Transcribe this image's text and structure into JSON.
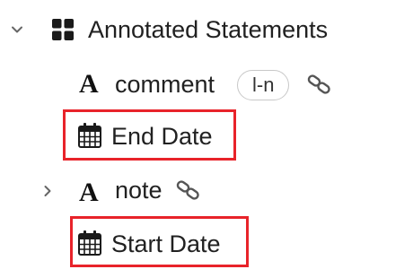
{
  "colors": {
    "text": "#212121",
    "muted_icon": "#555555",
    "highlight": "#e8232a"
  },
  "tree": {
    "root": {
      "label": "Annotated Statements",
      "expander_icon": "chevron-down-icon",
      "type_icon": "grid-icon"
    },
    "items": [
      {
        "label": "comment",
        "type_icon": "text-type-icon",
        "type_glyph": "A",
        "badge": "l-n",
        "link_icon": "link-icon"
      },
      {
        "label": "End Date",
        "type_icon": "calendar-icon",
        "highlighted": true
      },
      {
        "label": "note",
        "type_icon": "text-type-icon",
        "type_glyph": "A",
        "expander_icon": "chevron-right-icon",
        "link_icon": "link-icon"
      },
      {
        "label": "Start Date",
        "type_icon": "calendar-icon",
        "highlighted": true
      }
    ]
  }
}
